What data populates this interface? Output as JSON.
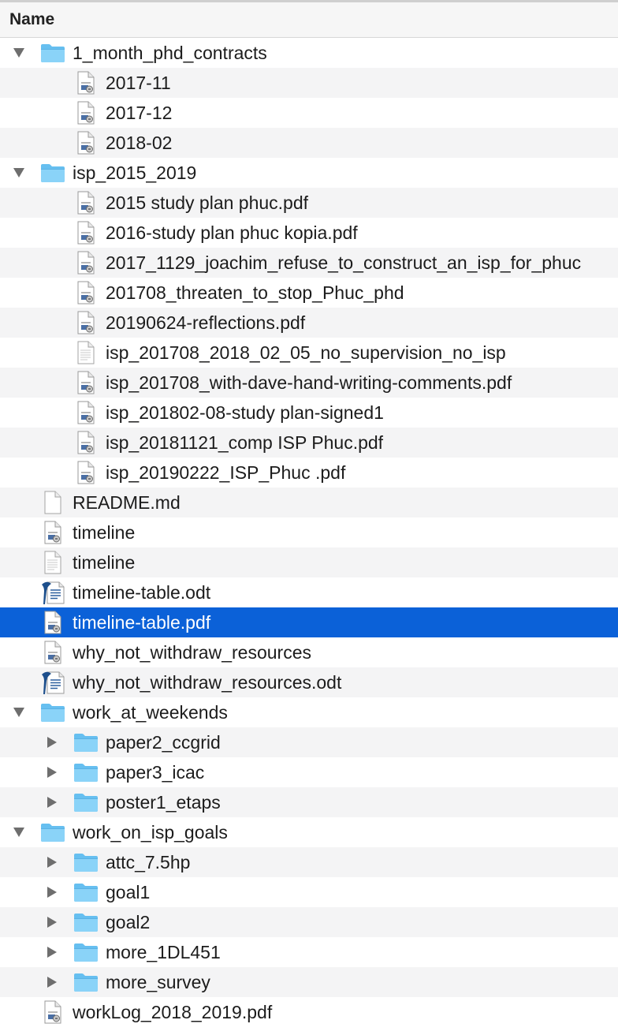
{
  "header": {
    "name_label": "Name"
  },
  "rows": [
    {
      "depth": 0,
      "type": "folder",
      "expanded": true,
      "label": "1_month_phd_contracts"
    },
    {
      "depth": 1,
      "type": "pdf",
      "label": "2017-11"
    },
    {
      "depth": 1,
      "type": "pdf",
      "label": "2017-12"
    },
    {
      "depth": 1,
      "type": "pdf",
      "label": "2018-02"
    },
    {
      "depth": 0,
      "type": "folder",
      "expanded": true,
      "label": "isp_2015_2019"
    },
    {
      "depth": 1,
      "type": "pdf",
      "label": "2015 study plan phuc.pdf"
    },
    {
      "depth": 1,
      "type": "pdf",
      "label": "2016-study plan phuc kopia.pdf"
    },
    {
      "depth": 1,
      "type": "pdf",
      "label": "2017_1129_joachim_refuse_to_construct_an_isp_for_phuc"
    },
    {
      "depth": 1,
      "type": "pdf",
      "label": "201708_threaten_to_stop_Phuc_phd"
    },
    {
      "depth": 1,
      "type": "pdf",
      "label": "20190624-reflections.pdf"
    },
    {
      "depth": 1,
      "type": "text",
      "label": "isp_201708_2018_02_05_no_supervision_no_isp"
    },
    {
      "depth": 1,
      "type": "pdf",
      "label": "isp_201708_with-dave-hand-writing-comments.pdf"
    },
    {
      "depth": 1,
      "type": "pdf",
      "label": "isp_201802-08-study plan-signed1"
    },
    {
      "depth": 1,
      "type": "pdf",
      "label": "isp_20181121_comp ISP Phuc.pdf"
    },
    {
      "depth": 1,
      "type": "pdf",
      "label": "isp_20190222_ISP_Phuc .pdf"
    },
    {
      "depth": 0,
      "type": "blank",
      "label": "README.md"
    },
    {
      "depth": 0,
      "type": "pdf",
      "label": "timeline"
    },
    {
      "depth": 0,
      "type": "text",
      "label": "timeline"
    },
    {
      "depth": 0,
      "type": "odt",
      "label": "timeline-table.odt"
    },
    {
      "depth": 0,
      "type": "pdf",
      "label": "timeline-table.pdf",
      "selected": true
    },
    {
      "depth": 0,
      "type": "pdf",
      "label": "why_not_withdraw_resources"
    },
    {
      "depth": 0,
      "type": "odt",
      "label": "why_not_withdraw_resources.odt"
    },
    {
      "depth": 0,
      "type": "folder",
      "expanded": true,
      "label": "work_at_weekends"
    },
    {
      "depth": 1,
      "type": "folder",
      "expanded": false,
      "label": "paper2_ccgrid"
    },
    {
      "depth": 1,
      "type": "folder",
      "expanded": false,
      "label": "paper3_icac"
    },
    {
      "depth": 1,
      "type": "folder",
      "expanded": false,
      "label": "poster1_etaps"
    },
    {
      "depth": 0,
      "type": "folder",
      "expanded": true,
      "label": "work_on_isp_goals"
    },
    {
      "depth": 1,
      "type": "folder",
      "expanded": false,
      "label": "attc_7.5hp"
    },
    {
      "depth": 1,
      "type": "folder",
      "expanded": false,
      "label": "goal1"
    },
    {
      "depth": 1,
      "type": "folder",
      "expanded": false,
      "label": "goal2"
    },
    {
      "depth": 1,
      "type": "folder",
      "expanded": false,
      "label": "more_1DL451"
    },
    {
      "depth": 1,
      "type": "folder",
      "expanded": false,
      "label": "more_survey"
    },
    {
      "depth": 0,
      "type": "pdf",
      "label": "workLog_2018_2019.pdf"
    }
  ],
  "colors": {
    "selection": "#0b61d8",
    "folder": "#7ccbf5",
    "stripe": "#f4f4f5"
  }
}
